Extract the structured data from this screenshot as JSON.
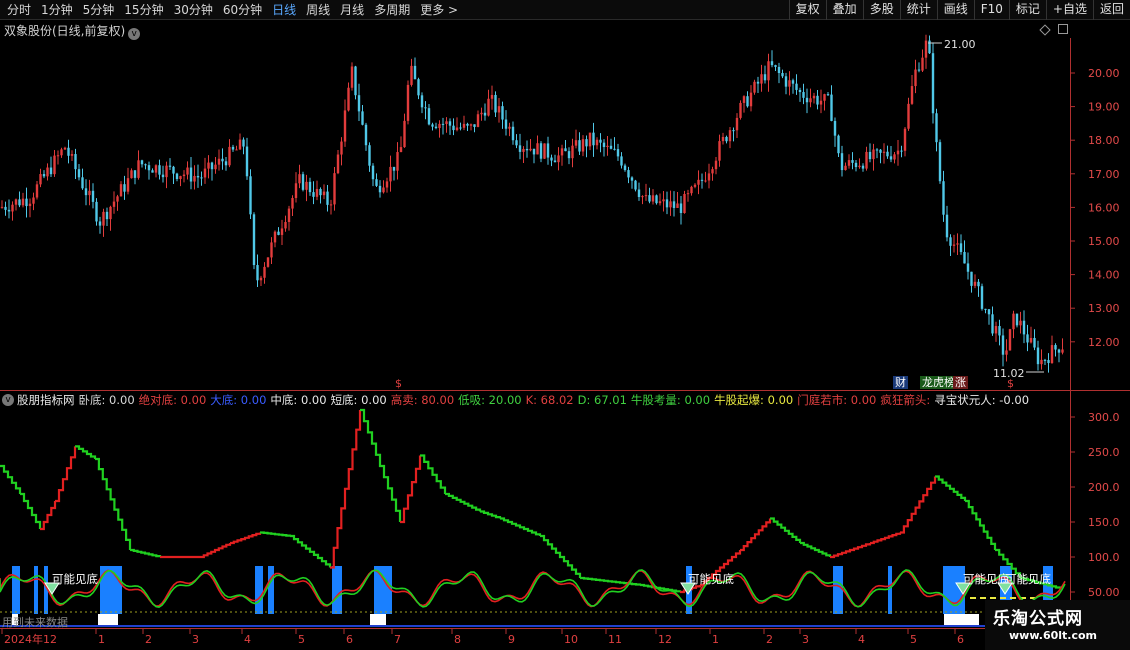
{
  "toolbar": {
    "periods": [
      "分时",
      "1分钟",
      "5分钟",
      "15分钟",
      "30分钟",
      "60分钟",
      "日线",
      "周线",
      "月线",
      "多周期",
      "更多 >"
    ],
    "active_period": "日线",
    "buttons": [
      "复权",
      "叠加",
      "多股",
      "统计",
      "画线",
      "F10",
      "标记",
      "+自选",
      "返回"
    ]
  },
  "main_chart": {
    "title": "双象股份(日线,前复权)",
    "price_axis": [
      "20.00",
      "19.00",
      "18.00",
      "17.00",
      "16.00",
      "15.00",
      "14.00",
      "13.00",
      "12.00"
    ],
    "high_label": "21.00",
    "low_label": "11.02",
    "badges": [
      {
        "text": "财",
        "color": "#3a78d8"
      },
      {
        "text": "龙虎榜",
        "color": "#3aa83a"
      },
      {
        "text": "涨",
        "color": "#d84a4a"
      }
    ],
    "dollar_marker": "$"
  },
  "indicator": {
    "name": "股朋指标网",
    "fields": [
      {
        "label": "卧底:",
        "value": "0.00",
        "color": "#d8d8d8"
      },
      {
        "label": "绝对底:",
        "value": "0.00",
        "color": "#e04040"
      },
      {
        "label": "大底:",
        "value": "0.00",
        "color": "#3a5cff"
      },
      {
        "label": "中底:",
        "value": "0.00",
        "color": "#e8e8e8"
      },
      {
        "label": "短底:",
        "value": "0.00",
        "color": "#e8e8e8"
      },
      {
        "label": "高卖:",
        "value": "80.00",
        "color": "#e04040"
      },
      {
        "label": "低吸:",
        "value": "20.00",
        "color": "#40d040"
      },
      {
        "label": "K:",
        "value": "68.02",
        "color": "#e04040"
      },
      {
        "label": "D:",
        "value": "67.01",
        "color": "#40d040"
      },
      {
        "label": "牛股考量:",
        "value": "0.00",
        "color": "#40d040"
      },
      {
        "label": "牛股起爆:",
        "value": "0.00",
        "color": "#e8e840"
      },
      {
        "label": "门庭若市:",
        "value": "0.00",
        "color": "#e04040"
      },
      {
        "label": "疯狂箭头:",
        "value": "",
        "color": "#e04040"
      },
      {
        "label": "寻宝状元人:",
        "value": "-0.00",
        "color": "#e8e8e8"
      }
    ],
    "axis": [
      "300.0",
      "250.0",
      "200.0",
      "150.0",
      "100.0",
      "50.00"
    ],
    "signal_labels": [
      "可能见底",
      "可能见底",
      "可能见底",
      "可能见底"
    ],
    "bottom_note": "用到未来数据"
  },
  "date_axis": {
    "labels": [
      "2024年12",
      "1",
      "2",
      "3",
      "4",
      "5",
      "6",
      "7",
      "8",
      "9",
      "10",
      "11",
      "12",
      "1",
      "2",
      "3",
      "4",
      "5",
      "6"
    ]
  },
  "watermark": {
    "title": "乐淘公式网",
    "url": "www.60lt.com"
  }
}
